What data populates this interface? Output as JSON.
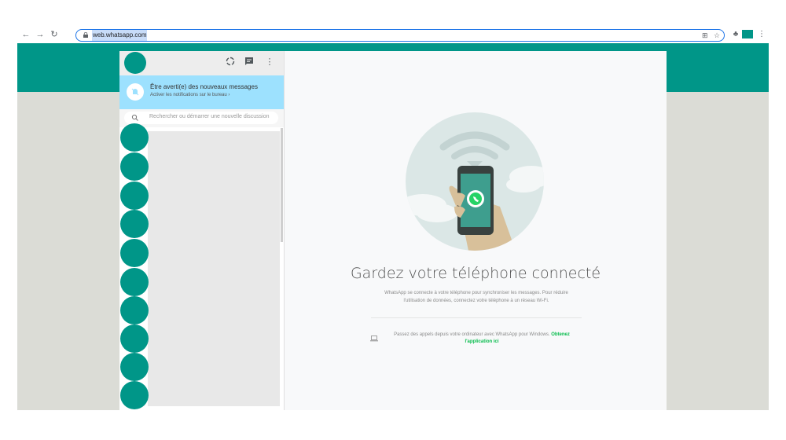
{
  "browser": {
    "url": "web.whatsapp.com",
    "ext_color": "#009688"
  },
  "colors": {
    "accent": "#009688",
    "notification_bg": "#9de1fe",
    "link_green": "#07bc4c",
    "background": "#dbdcd6"
  },
  "sidebar": {
    "header_icons": [
      "status-icon",
      "new-chat-icon",
      "menu-icon"
    ],
    "notification": {
      "title": "Être averti(e) des nouveaux messages",
      "subtitle": "Activer les notifications sur le bureau ›"
    },
    "search": {
      "placeholder": "Rechercher ou démarrer une nouvelle discussion"
    }
  },
  "main": {
    "title": "Gardez votre téléphone connecté",
    "description": "WhatsApp se connecte à votre téléphone pour synchroniser les messages. Pour réduire l'utilisation de données, connectez votre téléphone à un réseau Wi-Fi.",
    "calls_text": "Passez des appels depuis votre ordinateur avec WhatsApp pour Windows.",
    "calls_link": "Obtenez l'application ici"
  }
}
